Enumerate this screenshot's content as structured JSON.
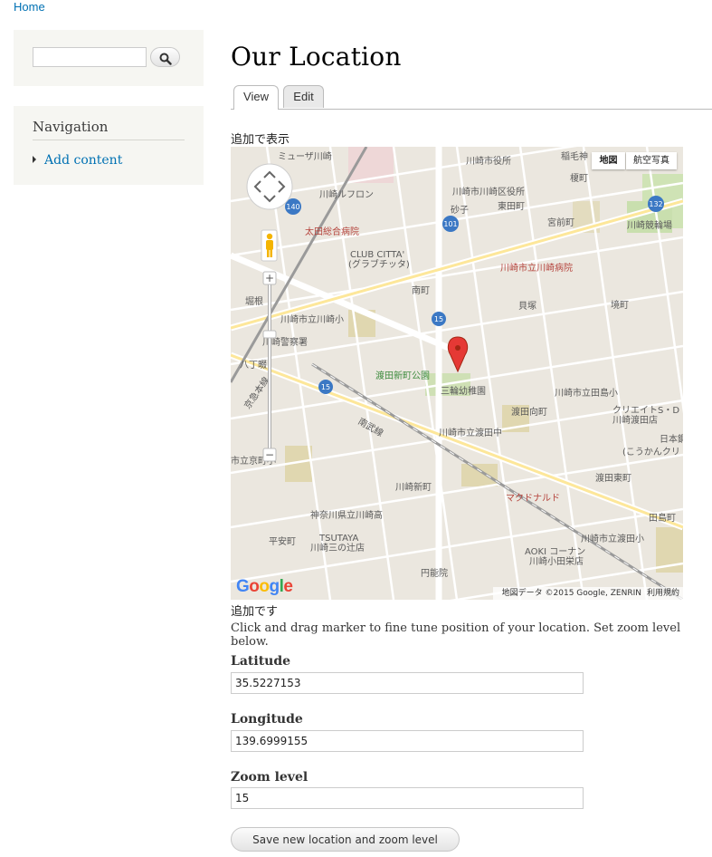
{
  "breadcrumb": {
    "home": "Home"
  },
  "navigation": {
    "title": "Navigation",
    "items": [
      {
        "label": "Add content"
      }
    ]
  },
  "page": {
    "title": "Our Location"
  },
  "tabs": [
    {
      "label": "View",
      "active": true
    },
    {
      "label": "Edit",
      "active": false
    }
  ],
  "map_section": {
    "label_top": "追加で表示",
    "label_bottom": "追加です",
    "help": "Click and drag marker to fine tune position of your location. Set zoom level below."
  },
  "map": {
    "type_buttons": [
      "地図",
      "航空写真"
    ],
    "attribution": "地図データ ©2015 Google, ZENRIN",
    "terms": "利用規約",
    "logo": "Google",
    "place_labels": [
      "ミューザ川崎",
      "川崎市役所",
      "稲毛神",
      "榎町",
      "川崎市川崎区役所",
      "砂子",
      "東田町",
      "川崎ルフロン",
      "太田総合病院",
      "宮前町",
      "川崎競輪場",
      "CLUB CITTA'",
      "(グラブチッタ)",
      "川崎市立川崎病院",
      "堀根",
      "南町",
      "貝塚",
      "境町",
      "川崎市立川崎小",
      "川崎警察署",
      "八丁畷",
      "渡田新町公園",
      "三輪幼稚園",
      "川崎市立田島小",
      "渡田向町",
      "クリエイトS・D",
      "川崎渡田店",
      "川崎市立渡田中",
      "日本鋼",
      "(こうかんクリ",
      "京急本線",
      "南武線",
      "渡田東町",
      "市立京町小",
      "川崎新町",
      "マクドナルド",
      "神奈川県立川崎高",
      "田島町",
      "TSUTAYA",
      "川崎三の辻店",
      "平安町",
      "川崎市立渡田小",
      "AOKI コーナン",
      "川崎小田栄店",
      "円能院"
    ],
    "route_shields": [
      "140",
      "101",
      "132",
      "15",
      "15"
    ]
  },
  "fields": {
    "latitude": {
      "label": "Latitude",
      "value": "35.5227153"
    },
    "longitude": {
      "label": "Longitude",
      "value": "139.6999155"
    },
    "zoom": {
      "label": "Zoom level",
      "value": "15"
    }
  },
  "save_button": {
    "label": "Save new location and zoom level"
  },
  "colors": {
    "link": "#0071b3",
    "sidebar_bg": "#f6f6f2",
    "map_bg": "#ebe7df",
    "marker": "#e53935"
  }
}
